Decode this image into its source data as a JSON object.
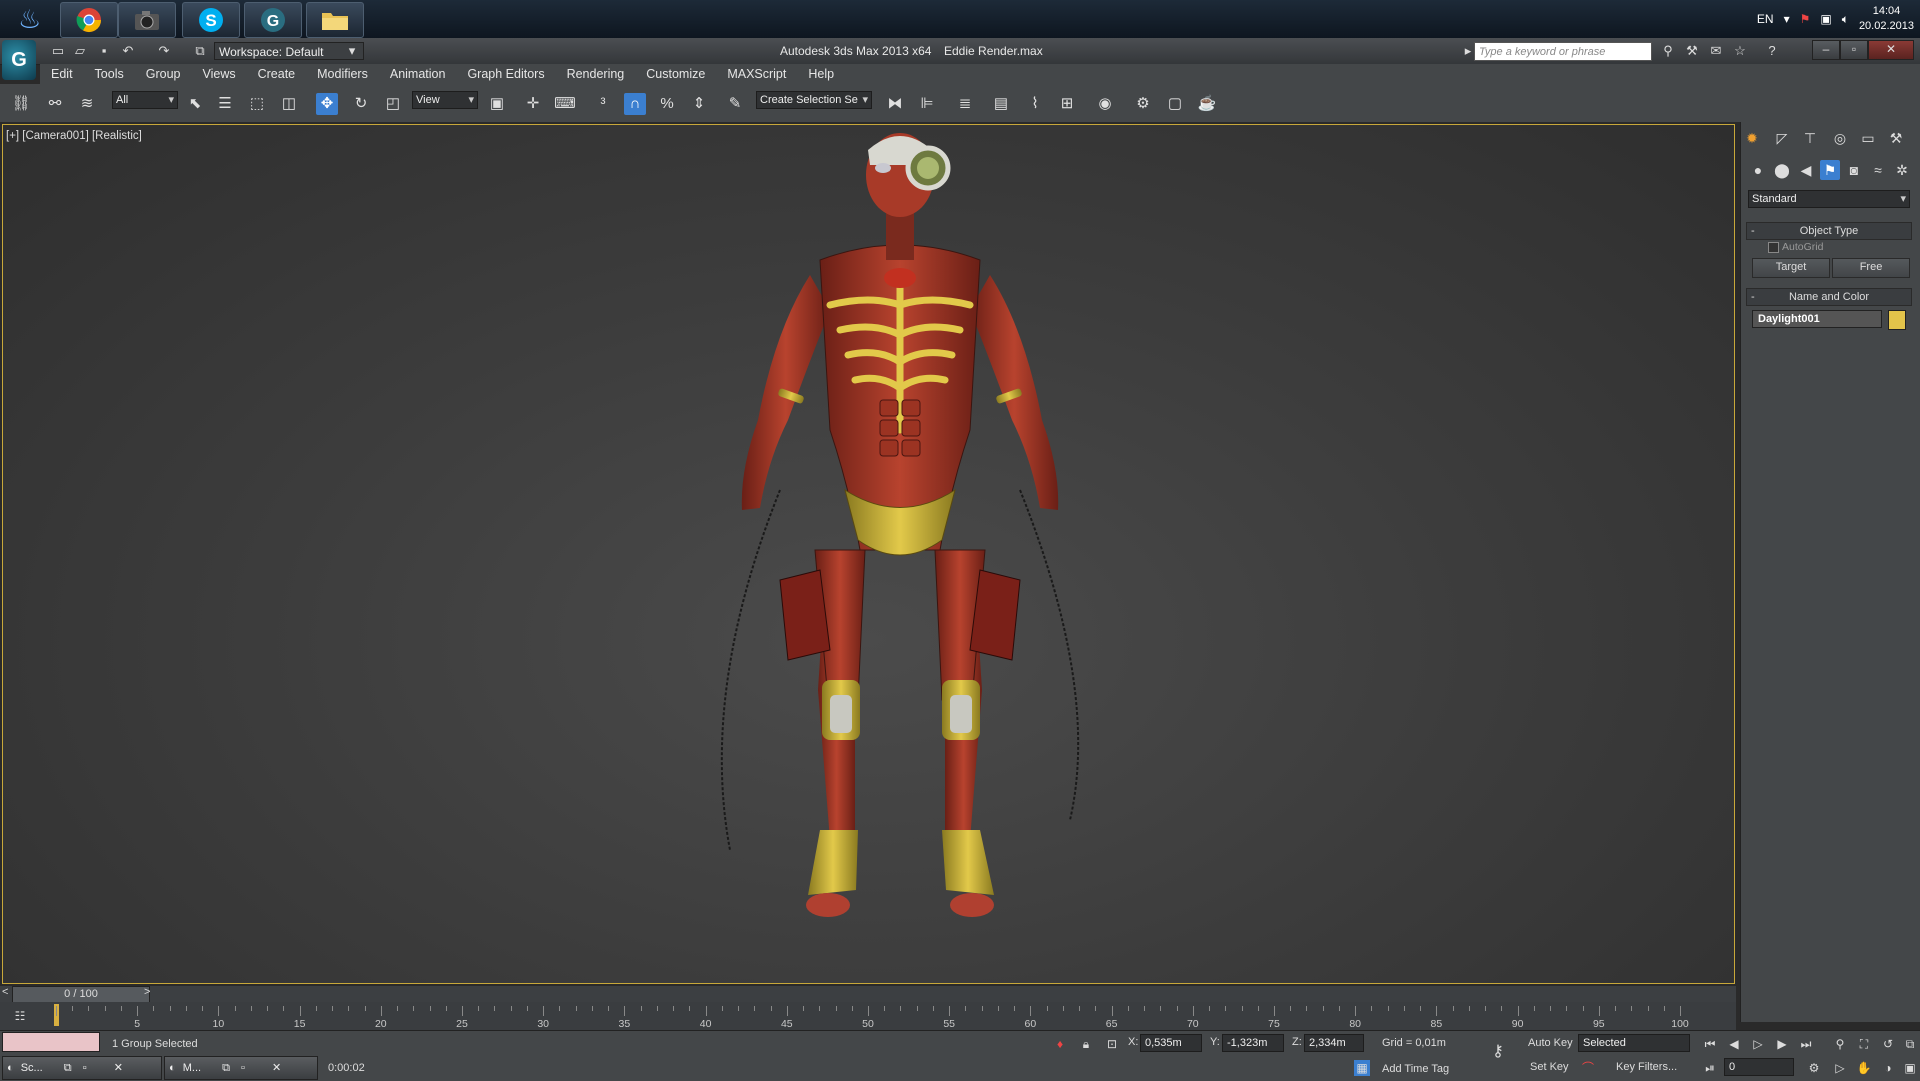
{
  "taskbar": {
    "apps": [
      {
        "name": "3ds-max-launcher-icon"
      },
      {
        "name": "chrome-icon"
      },
      {
        "name": "camera-app-icon"
      },
      {
        "name": "skype-icon"
      },
      {
        "name": "3ds-max-icon"
      },
      {
        "name": "folder-icon"
      }
    ],
    "language": "EN",
    "time": "14:04",
    "date": "20.02.2013"
  },
  "titlebar": {
    "workspace": "Workspace: Default",
    "app_title": "Autodesk 3ds Max  2013 x64",
    "file_name": "Eddie Render.max",
    "search_placeholder": "Type a keyword or phrase"
  },
  "menu": [
    "Edit",
    "Tools",
    "Group",
    "Views",
    "Create",
    "Modifiers",
    "Animation",
    "Graph Editors",
    "Rendering",
    "Customize",
    "MAXScript",
    "Help"
  ],
  "toolbar": {
    "selection_filter": "All",
    "ref_coord": "View",
    "named_selection": "Create Selection Se"
  },
  "viewport": {
    "label": "[+] [Camera001] [Realistic]"
  },
  "command_panel": {
    "category": "Standard",
    "object_type_title": "Object Type",
    "autogrid_label": "AutoGrid",
    "target_button": "Target",
    "free_button": "Free",
    "name_color_title": "Name and Color",
    "object_name": "Daylight001",
    "object_color": "#e3c44a"
  },
  "timeline": {
    "frame_display": "0 / 100",
    "ticks": [
      "5",
      "10",
      "15",
      "20",
      "25",
      "30",
      "35",
      "40",
      "45",
      "50",
      "55",
      "60",
      "65",
      "70",
      "75",
      "80",
      "85",
      "90",
      "95",
      "100"
    ]
  },
  "status": {
    "selection_status": "1 Group Selected",
    "render_time": "0:00:02",
    "x_label": "X:",
    "x_value": "0,535m",
    "y_label": "Y:",
    "y_value": "-1,323m",
    "z_label": "Z:",
    "z_value": "2,334m",
    "grid": "Grid = 0,01m",
    "add_time_tag": "Add Time Tag",
    "auto_key": "Auto Key",
    "set_key": "Set Key",
    "key_mode": "Selected",
    "key_filters": "Key Filters...",
    "current_frame": "0"
  },
  "min_windows": [
    {
      "label": "Sc..."
    },
    {
      "label": "M..."
    }
  ],
  "colors": {
    "viewport_border": "#c8a83a",
    "active_tool": "#3b7fd0"
  }
}
